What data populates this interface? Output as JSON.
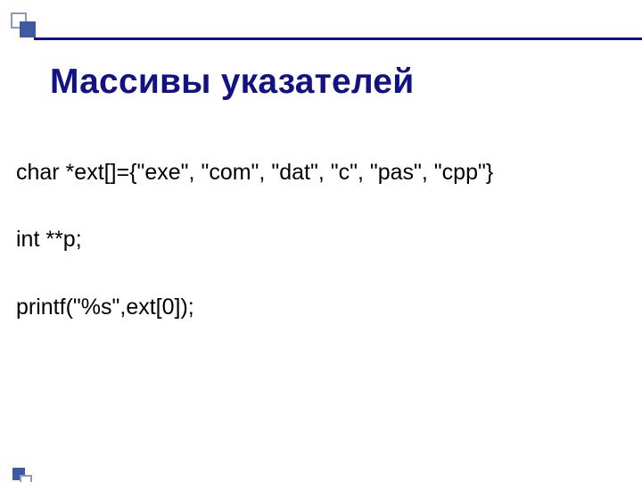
{
  "title": "Массивы указателей",
  "lines": [
    "char *ext[]={\"exe\", \"com\", \"dat\", \"c\", \"pas\", \"cpp\"}",
    "int **p;",
    "printf(\"%s\",ext[0]);"
  ]
}
